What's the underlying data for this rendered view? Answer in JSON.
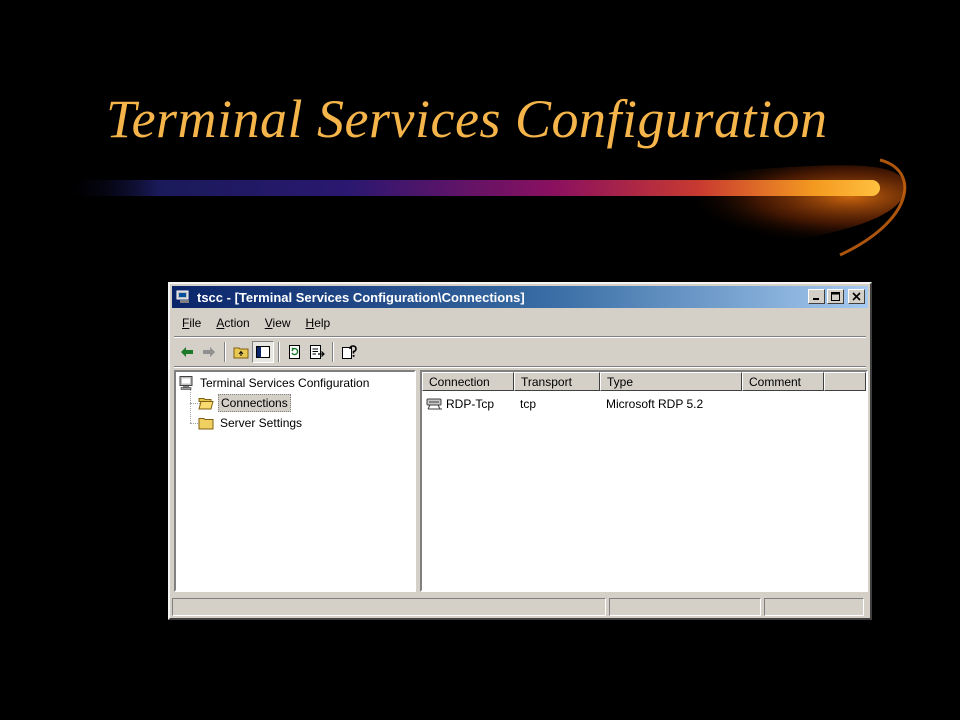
{
  "slide": {
    "title": "Terminal Services Configuration"
  },
  "window": {
    "title": "tscc - [Terminal Services Configuration\\Connections]",
    "controls": [
      "minimize",
      "maximize",
      "close"
    ]
  },
  "menu": [
    {
      "label": "File",
      "accel": "F",
      "rest": "ile"
    },
    {
      "label": "Action",
      "accel": "A",
      "rest": "ction"
    },
    {
      "label": "View",
      "accel": "V",
      "rest": "iew"
    },
    {
      "label": "Help",
      "accel": "H",
      "rest": "elp"
    }
  ],
  "toolbar": [
    "back-arrow-icon",
    "forward-arrow-icon",
    "up-folder-icon",
    "show-hide-tree-icon",
    "refresh-icon",
    "export-list-icon",
    "help-icon"
  ],
  "tree": {
    "root": "Terminal Services Configuration",
    "children": [
      {
        "label": "Connections",
        "selected": true
      },
      {
        "label": "Server Settings",
        "selected": false
      }
    ]
  },
  "list": {
    "columns": [
      "Connection",
      "Transport",
      "Type",
      "Comment"
    ],
    "rows": [
      {
        "connection": "RDP-Tcp",
        "transport": "tcp",
        "type": "Microsoft RDP 5.2",
        "comment": ""
      }
    ]
  },
  "colors": {
    "title_text": "#f5b54a",
    "titlebar_start": "#0a246a",
    "titlebar_end": "#a6caf0",
    "window_face": "#d4d0c8"
  }
}
